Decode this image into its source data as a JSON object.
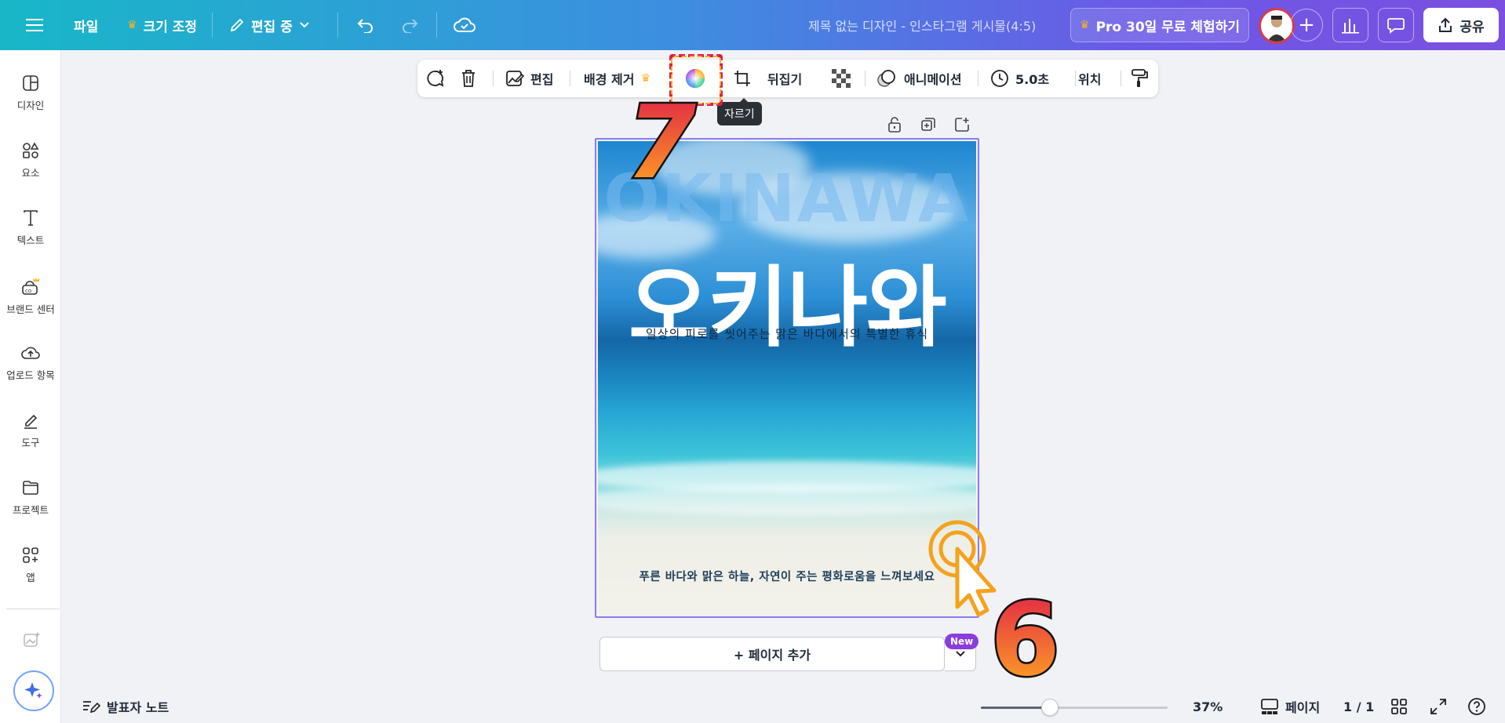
{
  "header": {
    "file_label": "파일",
    "resize_label": "크기 조정",
    "editing_label": "편집 중",
    "doc_title": "제목 없는 디자인 - 인스타그램 게시물(4:5)",
    "pro_label": "Pro 30일 무료 체험하기",
    "share_label": "공유"
  },
  "sidebar": {
    "items": [
      {
        "label": "디자인",
        "icon": "layout-icon"
      },
      {
        "label": "요소",
        "icon": "shapes-icon"
      },
      {
        "label": "텍스트",
        "icon": "text-icon"
      },
      {
        "label": "브랜드 센터",
        "icon": "brand-icon"
      },
      {
        "label": "업로드 항목",
        "icon": "upload-cloud-icon"
      },
      {
        "label": "도구",
        "icon": "draw-tool-icon"
      },
      {
        "label": "프로젝트",
        "icon": "folder-icon"
      },
      {
        "label": "앱",
        "icon": "apps-icon"
      }
    ]
  },
  "toolbar": {
    "edit_label": "편집",
    "bg_remove_label": "배경 제거",
    "flip_label": "뒤집기",
    "animation_label": "애니메이션",
    "duration_label": "5.0초",
    "position_label": "위치",
    "crop_tooltip": "자르기"
  },
  "canvas": {
    "title_en": "OKINAWA",
    "title_kr": "오키나와",
    "subtitle": "일상의 피로를 씻어주는 맑은 바다에서의 특별한 휴식",
    "caption": "푸른 바다와 맑은 하늘, 자연이 주는 평화로움을 느껴보세요"
  },
  "add_page": {
    "label": "+ 페이지 추가",
    "badge": "New"
  },
  "bottom": {
    "notes_label": "발표자 노트",
    "zoom_label": "37%",
    "zoom_fraction": 0.37,
    "pages_label": "페이지",
    "page_count": "1 / 1"
  },
  "annotations": {
    "step_7": "7",
    "step_6": "6"
  },
  "colors": {
    "header_start": "#18b7c8",
    "header_end": "#7b4fe0",
    "selection": "#8b7bf0",
    "highlight_red": "#e01c49",
    "accent_orange": "#ffb020"
  }
}
